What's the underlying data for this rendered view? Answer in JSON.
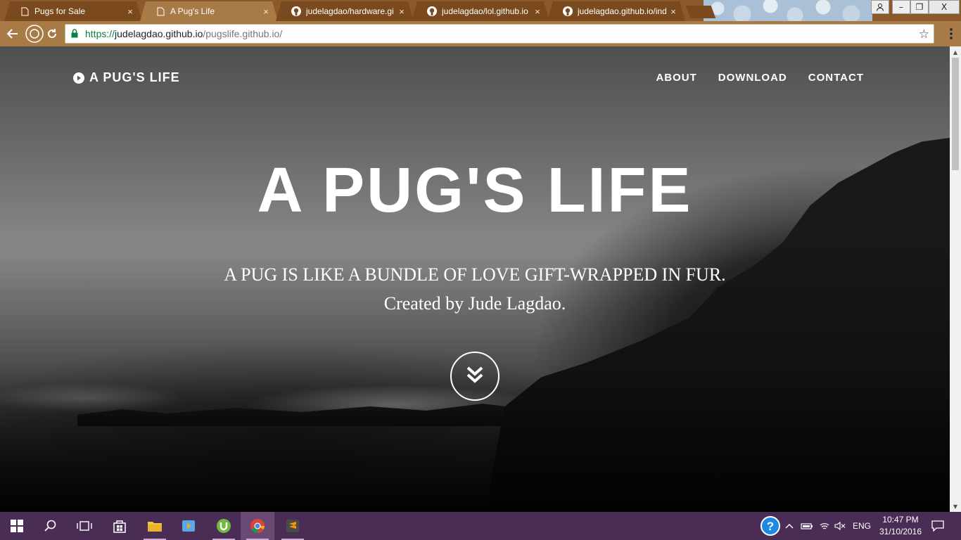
{
  "browser": {
    "tabs": [
      {
        "title": "Pugs for Sale",
        "icon": "page-icon",
        "active": false
      },
      {
        "title": "A Pug's Life",
        "icon": "page-icon",
        "active": true
      },
      {
        "title": "judelagdao/hardware.gi",
        "icon": "github-icon",
        "active": false
      },
      {
        "title": "judelagdao/lol.github.io",
        "icon": "github-icon",
        "active": false
      },
      {
        "title": "judelagdao.github.io/ind",
        "icon": "github-icon",
        "active": false
      }
    ],
    "close_glyph": "×",
    "address": {
      "scheme": "https://",
      "host": "judelagdao.github.io",
      "path": "/pugslife.github.io/"
    },
    "window_buttons": {
      "minimize": "–",
      "maximize": "❐",
      "close": "X"
    }
  },
  "page": {
    "brand": "A PUG'S LIFE",
    "nav": [
      "ABOUT",
      "DOWNLOAD",
      "CONTACT"
    ],
    "hero": {
      "title": "A PUG'S LIFE",
      "subtitle_line1": "A PUG IS LIKE A BUNDLE OF LOVE GIFT-WRAPPED IN FUR.",
      "subtitle_line2": "Created by Jude Lagdao."
    }
  },
  "taskbar": {
    "language": "ENG",
    "time": "10:47 PM",
    "date": "31/10/2016",
    "apps": [
      "start-icon",
      "search-icon",
      "task-view-icon",
      "store-icon",
      "file-explorer-icon",
      "media-player-icon",
      "utorrent-icon",
      "chrome-icon",
      "sublime-text-icon"
    ]
  },
  "colors": {
    "titlebar": "#8a5a2b",
    "toolbar": "#a87a45",
    "taskbar": "#4a2d54",
    "secure_url": "#0b8043"
  }
}
